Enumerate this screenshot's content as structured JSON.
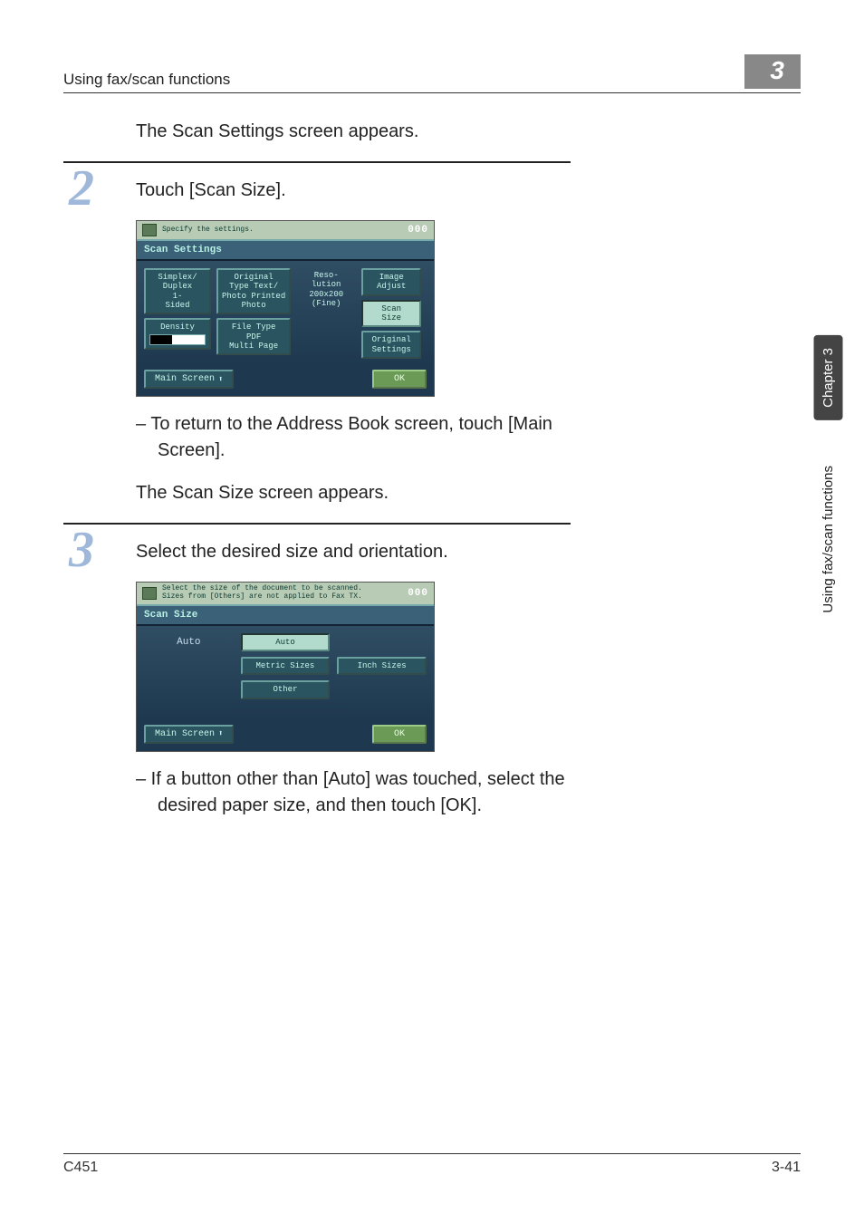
{
  "running_header": {
    "title": "Using fax/scan functions",
    "chapter_num": "3"
  },
  "sidetabs": {
    "chapter": "Chapter 3",
    "section": "Using fax/scan functions"
  },
  "intro_line": "The Scan Settings screen appears.",
  "step2": {
    "num": "2",
    "instruction": "Touch [Scan Size].",
    "note1": "– To return to the Address Book screen, touch [Main Screen].",
    "result": "The Scan Size screen appears."
  },
  "step3": {
    "num": "3",
    "instruction": "Select the desired size and orientation.",
    "note1": "– If a button other than [Auto] was touched, select the desired paper size, and then touch [OK]."
  },
  "scan_settings_screen": {
    "top_message": "Specify the settings.",
    "counter": "000",
    "title": "Scan Settings",
    "buttons": {
      "simplex_label": "Simplex/\nDuplex",
      "simplex_value": "1-\nSided",
      "original_type_label": "Original\nType",
      "original_type_value1": "Text/\nPhoto",
      "original_type_value2": "Printed\nPhoto",
      "resolution_label": "Reso-\nlution",
      "resolution_value": "200x200\n(Fine)",
      "image_adjust": "Image\nAdjust",
      "scan_size": "Scan\nSize",
      "original_settings": "Original\nSettings",
      "density": "Density",
      "file_type": "File Type",
      "file_type_value": "PDF\nMulti Page"
    },
    "footer": {
      "main": "Main Screen",
      "ok": "OK"
    }
  },
  "scan_size_screen": {
    "top_message": "Select the size of the document to be scanned.\nSizes from [Others] are not applied to Fax TX.",
    "counter": "000",
    "title": "Scan Size",
    "buttons": {
      "auto_static": "Auto",
      "auto": "Auto",
      "metric": "Metric Sizes",
      "inch": "Inch Sizes",
      "other": "Other"
    },
    "footer": {
      "main": "Main Screen",
      "ok": "OK"
    }
  },
  "page_footer": {
    "model": "C451",
    "page": "3-41"
  }
}
